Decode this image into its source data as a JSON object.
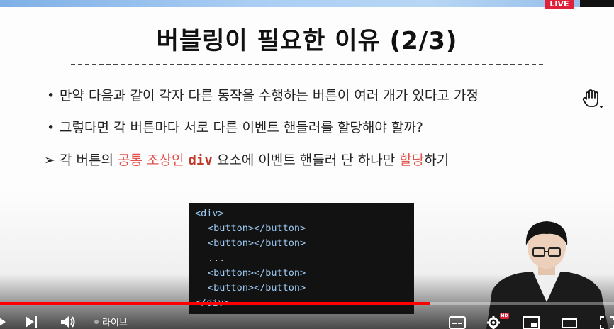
{
  "topbar": {
    "live_badge": "LIVE"
  },
  "slide": {
    "title": "버블링이 필요한 이유 (2/3)",
    "bullets": [
      {
        "marker": "•",
        "text": "만약 다음과 같이 각자 다른 동작을 수행하는 버튼이 여러 개가 있다고 가정"
      },
      {
        "marker": "•",
        "text": "그렇다면 각 버튼마다 서로 다른 이벤트 핸들러를 할당해야 할까?"
      }
    ],
    "conclusion": {
      "marker": "➢",
      "part1": "각 버튼의 ",
      "highlight1": "공통 조상인 ",
      "code": "div",
      "part2": " 요소에 이벤트 핸들러 단 하나만 ",
      "highlight2": "할당",
      "part3": "하기"
    },
    "code_lines": [
      {
        "open": "<div>",
        "text": "",
        "close": ""
      },
      {
        "open": "<button>",
        "text": "",
        "close": "</button>"
      },
      {
        "open": "<button>",
        "text": "",
        "close": "</button>"
      },
      {
        "open": "",
        "text": "...",
        "close": ""
      },
      {
        "open": "<button>",
        "text": "",
        "close": "</button>"
      },
      {
        "open": "<button>",
        "text": "",
        "close": "</button>"
      },
      {
        "open": "</div>",
        "text": "",
        "close": ""
      }
    ]
  },
  "player": {
    "live_label": "라이브",
    "progress": 0.7,
    "hd_label": "HD",
    "colors": {
      "progress": "#ff0000",
      "live": "#e0203a"
    }
  },
  "icons": [
    "hand-cursor-icon",
    "play-icon",
    "next-icon",
    "volume-icon",
    "subtitles-icon",
    "settings-icon",
    "miniplayer-icon",
    "theater-icon",
    "fullscreen-icon"
  ]
}
